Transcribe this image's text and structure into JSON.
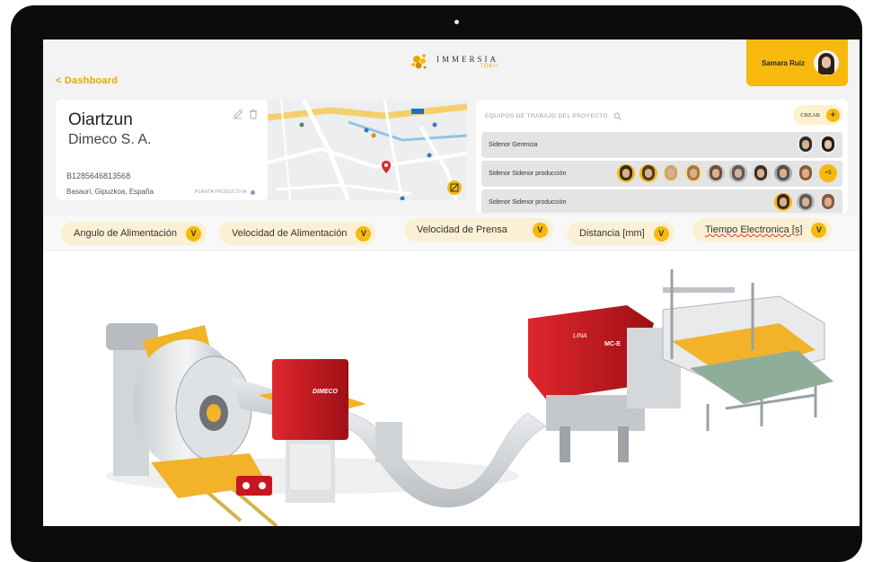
{
  "nav": {
    "back_label": "< Dashboard"
  },
  "brand": {
    "title": "IMMERSIA",
    "sub": "TOKII"
  },
  "user": {
    "name": "Samara Ruiz"
  },
  "company": {
    "name": "Oiartzun",
    "legal_name": "Dimeco S. A.",
    "id": "B1285646813568",
    "location": "Basauri, Gipuzkoa, España",
    "tag": "PLANTA PRODUCTIVA"
  },
  "teams": {
    "title": "EQUIPOS DE TRABAJO DEL PROYECTO",
    "create_label": "CREAR",
    "rows": [
      {
        "label": "Sidenor Gerencia",
        "members": 2
      },
      {
        "label": "Sidenor Sidenor producción",
        "members": 10,
        "more": "+5"
      },
      {
        "label": "Sidenor Sidenor producción",
        "members": 3
      }
    ]
  },
  "parameters": [
    {
      "label": "Angulo de Alimentación",
      "badge": "V"
    },
    {
      "label": "Velocidad de Alimentación",
      "badge": "V"
    },
    {
      "label": "Velocidad de Prensa",
      "badge": "V"
    },
    {
      "label": "Distancia [mm]",
      "badge": "V"
    },
    {
      "label": "Tiempo Electronica [s]",
      "badge": "V"
    }
  ],
  "machine": {
    "brand_label": "DIMECO",
    "press_label": "LINA",
    "press_model": "MC-E"
  },
  "colors": {
    "accent": "#f6b90c",
    "machine_red": "#c8161d",
    "background": "#f3f3f3"
  },
  "icons": [
    "edit-icon",
    "trash-icon",
    "search-icon",
    "plus-icon",
    "map-pin-icon"
  ]
}
